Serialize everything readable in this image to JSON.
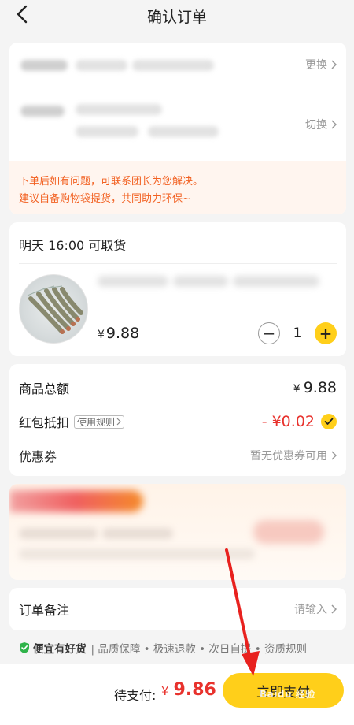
{
  "header": {
    "title": "确认订单"
  },
  "address": {
    "change_label": "更换",
    "switch_label": "切换",
    "notice_lines": [
      "下单后如有问题，可联系团长为您解决。",
      "建议自备购物袋提货，共同助力环保~"
    ]
  },
  "product": {
    "pickup_time": "明天 16:00 可取货",
    "price_symbol": "¥",
    "price": "9.88",
    "quantity": "1",
    "minus": "−",
    "plus": "+"
  },
  "totals": {
    "goods_total_label": "商品总额",
    "goods_total_symbol": "¥",
    "goods_total_value": "9.88",
    "redpacket_label": "红包抵扣",
    "redpacket_rules": "使用规则",
    "redpacket_value": "- ¥0.02",
    "coupon_label": "优惠券",
    "coupon_value": "暂无优惠券可用"
  },
  "remark": {
    "label": "订单备注",
    "placeholder": "请输入"
  },
  "guarantee": {
    "brand": "便宜有好货",
    "items": "|  品质保障 • 极速退款 • 次日自提 • 资质规则"
  },
  "bottom": {
    "due_label": "待支付:",
    "due_symbol": "¥",
    "due_value": "9.86",
    "pay_button": "立即支付",
    "watermark": "Baidu 经验"
  },
  "colors": {
    "accent": "#ffcf1a",
    "price_red": "#e8322d",
    "notice": "#f26122"
  }
}
